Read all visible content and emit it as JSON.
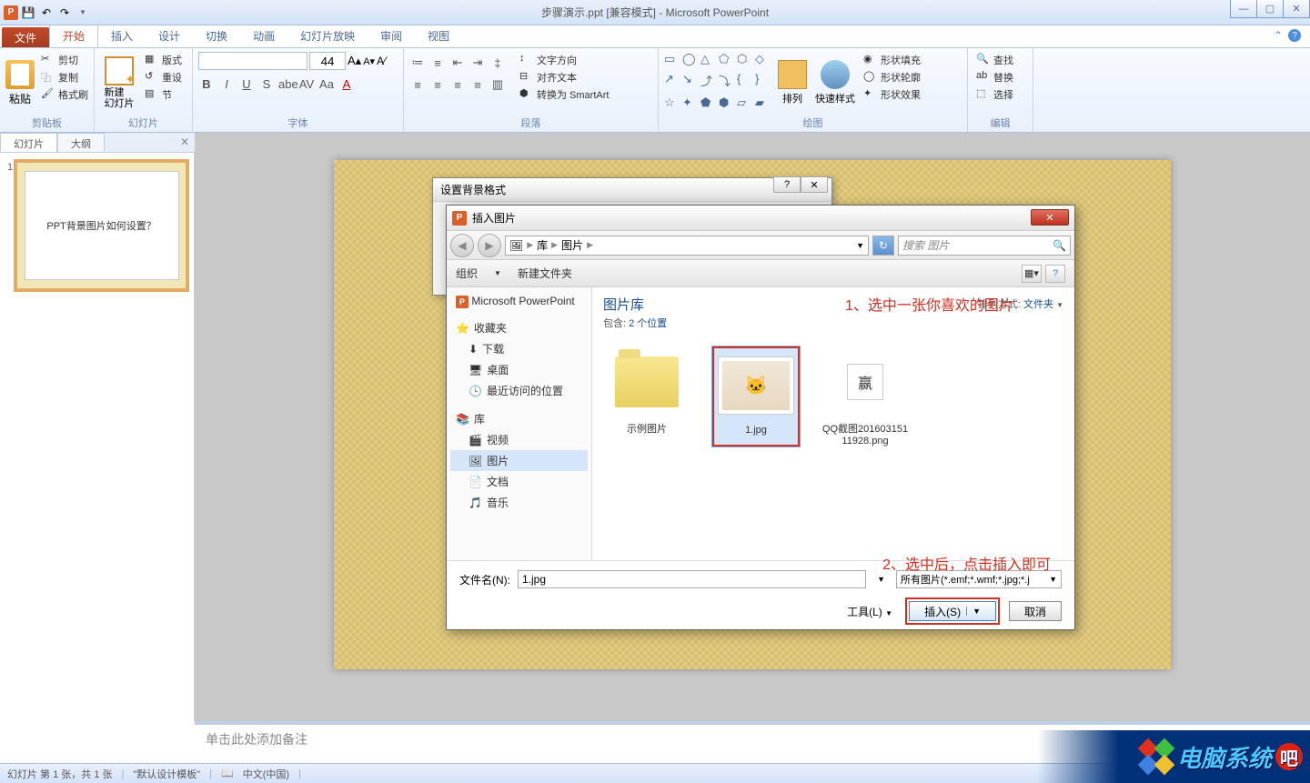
{
  "titlebar": {
    "title": "步骤演示.ppt [兼容模式] - Microsoft PowerPoint"
  },
  "ribbon": {
    "file": "文件",
    "tabs": [
      "开始",
      "插入",
      "设计",
      "切换",
      "动画",
      "幻灯片放映",
      "审阅",
      "视图"
    ],
    "active_tab": 0,
    "clipboard": {
      "label": "剪贴板",
      "paste": "粘贴",
      "cut": "剪切",
      "copy": "复制",
      "format_painter": "格式刷"
    },
    "slides": {
      "label": "幻灯片",
      "new_slide": "新建\n幻灯片",
      "layout": "版式",
      "reset": "重设",
      "section": "节"
    },
    "font": {
      "label": "字体",
      "size": "44"
    },
    "para": {
      "label": "段落",
      "text_dir": "文字方向",
      "align_text": "对齐文本",
      "smartart": "转换为 SmartArt"
    },
    "drawing": {
      "label": "绘图",
      "arrange": "排列",
      "quick_styles": "快速样式",
      "shape_fill": "形状填充",
      "shape_outline": "形状轮廓",
      "shape_effects": "形状效果"
    },
    "editing": {
      "label": "编辑",
      "find": "查找",
      "replace": "替换",
      "select": "选择"
    }
  },
  "slides_pane": {
    "tab_slides": "幻灯片",
    "tab_outline": "大纲",
    "slide1_num": "1",
    "slide1_text": "PPT背景图片如何设置？"
  },
  "notes": {
    "placeholder": "单击此处添加备注"
  },
  "status": {
    "slide_info": "幻灯片 第 1 张，共 1 张",
    "theme": "\"默认设计模板\"",
    "lang": "中文(中国)"
  },
  "dialog_bg": {
    "title": "设置背景格式",
    "help": "?",
    "close": "✕"
  },
  "dialog_insert": {
    "title": "插入图片",
    "breadcrumb": [
      "库",
      "图片"
    ],
    "search_placeholder": "搜索 图片",
    "organize": "组织",
    "new_folder": "新建文件夹",
    "side": {
      "powerpoint": "Microsoft PowerPoint",
      "fav": "收藏夹",
      "downloads": "下载",
      "desktop": "桌面",
      "recent": "最近访问的位置",
      "lib": "库",
      "videos": "视频",
      "pictures": "图片",
      "docs": "文档",
      "music": "音乐"
    },
    "lib_title": "图片库",
    "lib_includes_label": "包含:",
    "lib_includes_link": "2 个位置",
    "sort_label": "排列方式:",
    "sort_value": "文件夹",
    "files": [
      {
        "name": "示例图片",
        "type": "folder"
      },
      {
        "name": "1.jpg",
        "type": "image",
        "selected": true
      },
      {
        "name": "QQ截图20160315111928.png",
        "type": "image"
      }
    ],
    "annotation1": "1、选中一张你喜欢的图片",
    "annotation2": "2、选中后，点击插入即可",
    "filename_label": "文件名(N):",
    "filename_value": "1.jpg",
    "filetype": "所有图片(*.emf;*.wmf;*.jpg;*.jpeg;*.jfif;*.jpe;*.png;*.bmp;*.dib;*.rle;*.gif;*.emz;*.wmz;*.tif;*.tiff;*.svg;*.ico)",
    "filetype_short": "所有图片(*.emf;*.wmf;*.jpg;*.j",
    "tools": "工具(L)",
    "insert": "插入(S)",
    "cancel": "取消"
  },
  "watermark": "电脑系统"
}
